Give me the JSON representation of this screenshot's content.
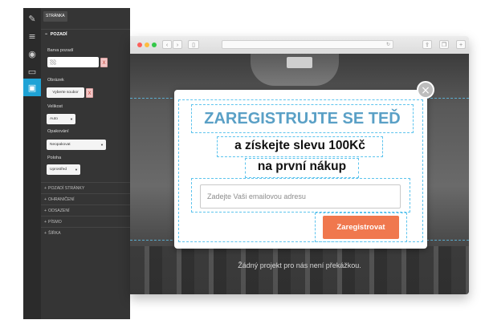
{
  "editor": {
    "toolbar_icons": [
      {
        "name": "pencil-icon",
        "glyph": "✎"
      },
      {
        "name": "list-icon",
        "glyph": "≡"
      },
      {
        "name": "eye-icon",
        "glyph": "◉"
      },
      {
        "name": "monitor-icon",
        "glyph": "▭"
      },
      {
        "name": "save-icon",
        "glyph": "▣"
      }
    ],
    "active_icon": "save-icon",
    "tab_label": "STRÁNKA",
    "section_title": "POZADÍ",
    "background_color_label": "Barva pozadí",
    "image_label": "Obrázek",
    "file_button": "Vyberte soubor",
    "remove_label": "X",
    "size_label": "Velikost",
    "size_value": "Auto",
    "repeat_label": "Opakování",
    "repeat_value": "Neopakovat",
    "position_label": "Poloha",
    "position_value": "Uprostřed",
    "collapsed_sections": [
      "POZADÍ STRÁNKY",
      "OHRANIČENÍ",
      "ODSAZENÍ",
      "PÍSMO",
      "ŠÍŘKA"
    ],
    "accent_color": "#1fa3d6"
  },
  "browser": {
    "traffic_lights": [
      "#fc605b",
      "#fdbc40",
      "#34c84a"
    ]
  },
  "site": {
    "tagline": "Žádný projekt pro nás není překážkou."
  },
  "popup": {
    "headline": "ZAREGISTRUJTE SE TEĎ",
    "subline_1": "a získejte slevu 100Kč",
    "subline_2": "na první nákup",
    "email_placeholder": "Zadejte Vaši emailovou adresu",
    "submit_label": "Zaregistrovat",
    "close_glyph": "×",
    "headline_color": "#5aa0c6",
    "button_color": "#f0784e"
  }
}
